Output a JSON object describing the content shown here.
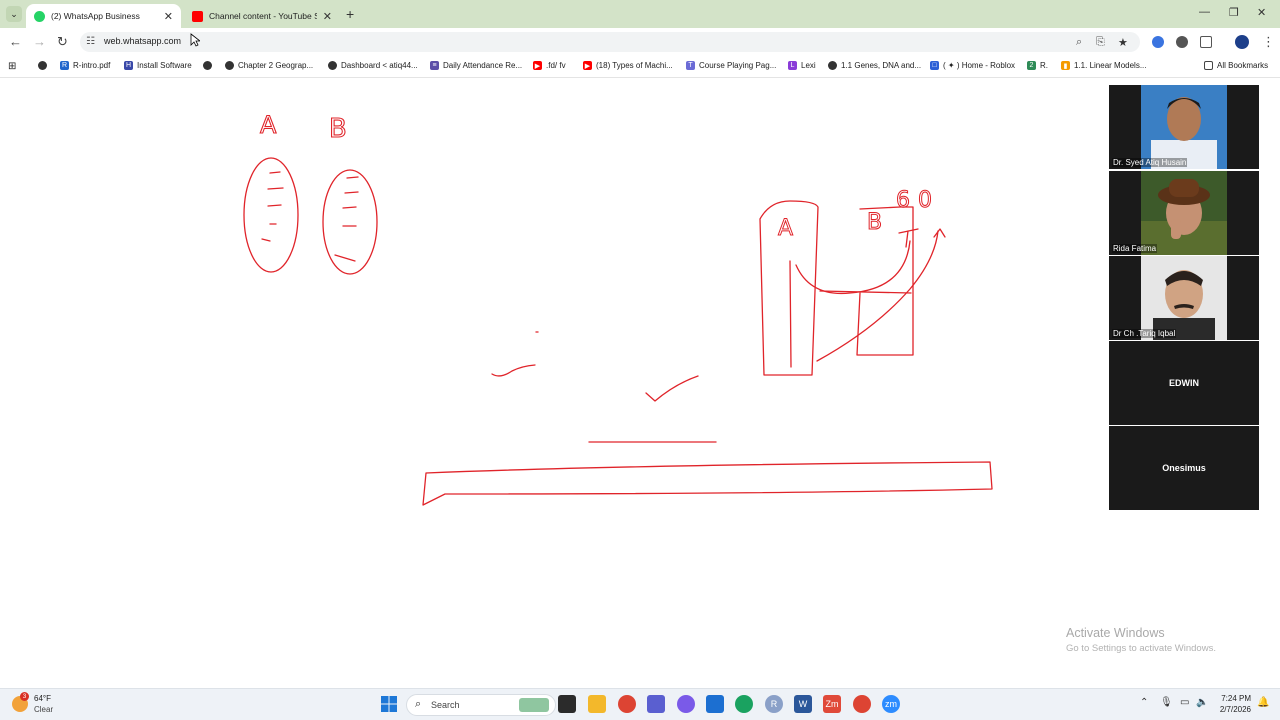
{
  "browser": {
    "tabs": [
      {
        "title": "(2) WhatsApp Business",
        "active": true,
        "icon": "whatsapp-icon",
        "badge": "2"
      },
      {
        "title": "Channel content - YouTube Stu",
        "active": false,
        "icon": "youtube-icon"
      }
    ],
    "url": "web.whatsapp.com",
    "bookmarks": [
      "R-intro.pdf",
      "Install Software",
      "Chapter 2 Geograp...",
      "Dashboard < atiq44...",
      "Daily Attendance Re...",
      ".fd/ fv",
      "(18) Types of Machi...",
      "Course Playing Pag...",
      "Lexi",
      "1.1 Genes, DNA and...",
      "( ✦ ) Home - Roblox",
      "R.",
      "1.1. Linear Models..."
    ],
    "all_bookmarks_label": "All Bookmarks"
  },
  "whiteboard": {
    "labels": {
      "left_a": "A",
      "left_b": "B",
      "right_a": "A",
      "right_b": "B",
      "sixty": "60"
    },
    "ink_color": "#e0242a"
  },
  "participants": [
    {
      "name": "Dr. Syed Atiq Husain",
      "video": true
    },
    {
      "name": "Rida Fatima",
      "video": true
    },
    {
      "name": "Dr Ch .Tariq Iqbal",
      "video": true
    },
    {
      "name": "EDWIN",
      "video": false
    },
    {
      "name": "Onesimus",
      "video": false
    }
  ],
  "watermark": {
    "title": "Activate Windows",
    "subtitle": "Go to Settings to activate Windows."
  },
  "taskbar": {
    "weather": {
      "temp": "64°F",
      "condition": "Clear",
      "badge": "3"
    },
    "search_placeholder": "Search",
    "time": "7:24 PM",
    "date": "2/7/2026"
  },
  "colors": {
    "tab_bar": "#d3e3c8",
    "accent": "#0b57d0",
    "ink": "#e0242a"
  }
}
